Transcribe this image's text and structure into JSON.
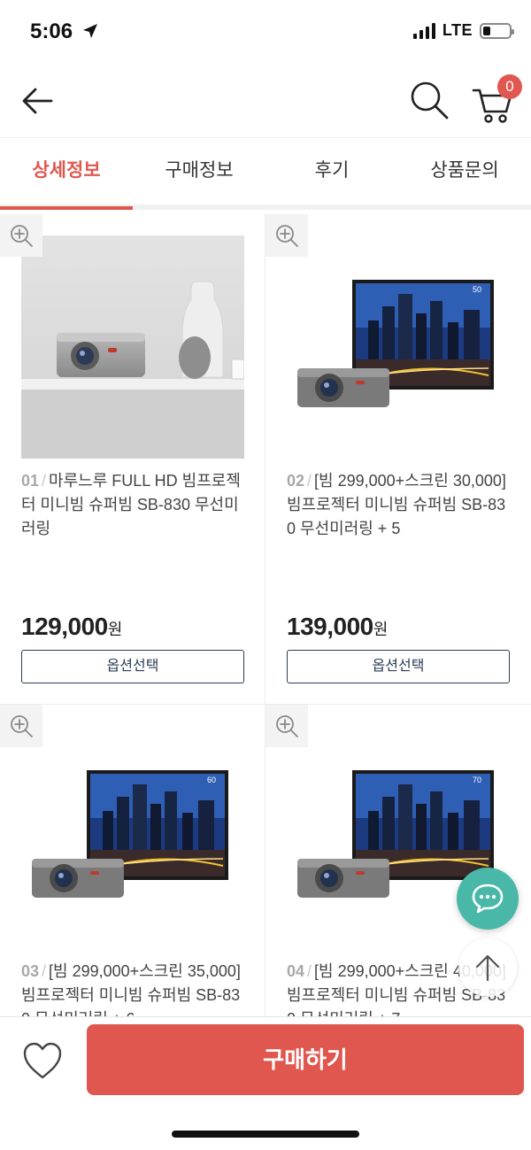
{
  "status_bar": {
    "time": "5:06",
    "network": "LTE"
  },
  "header": {
    "cart_count": "0"
  },
  "tabs": [
    {
      "label": "상세정보",
      "active": true
    },
    {
      "label": "구매정보",
      "active": false
    },
    {
      "label": "후기",
      "active": false
    },
    {
      "label": "상품문의",
      "active": false
    }
  ],
  "products": [
    {
      "num": "01",
      "title": "마루느루 FULL HD 빔프로젝터 미니빔 슈퍼빔 SB-830 무선미러링",
      "price": "129,000",
      "currency": "원",
      "option_label": "옵션선택",
      "image": "projector-on-shelf",
      "screen_label": ""
    },
    {
      "num": "02",
      "title": "[빔 299,000+스크린 30,000] 빔프로젝터 미니빔 슈퍼빔 SB-830 무선미러링 + 5",
      "price": "139,000",
      "currency": "원",
      "option_label": "옵션선택",
      "image": "projector-with-screen",
      "screen_label": "50"
    },
    {
      "num": "03",
      "title": "[빔 299,000+스크린 35,000] 빔프로젝터 미니빔 슈퍼빔 SB-830 무선미러링 + 6",
      "price": "",
      "currency": "",
      "option_label": "",
      "image": "projector-with-screen",
      "screen_label": "60"
    },
    {
      "num": "04",
      "title": "[빔 299,000+스크린 40,000] 빔프로젝터 미니빔 슈퍼빔 SB-830 무선미러링 + 7",
      "price": "",
      "currency": "",
      "option_label": "",
      "image": "projector-with-screen",
      "screen_label": "70"
    }
  ],
  "bottom_bar": {
    "buy_label": "구매하기"
  },
  "colors": {
    "accent": "#e0574f",
    "chat": "#49b8a8",
    "outline": "#2d3d55"
  }
}
